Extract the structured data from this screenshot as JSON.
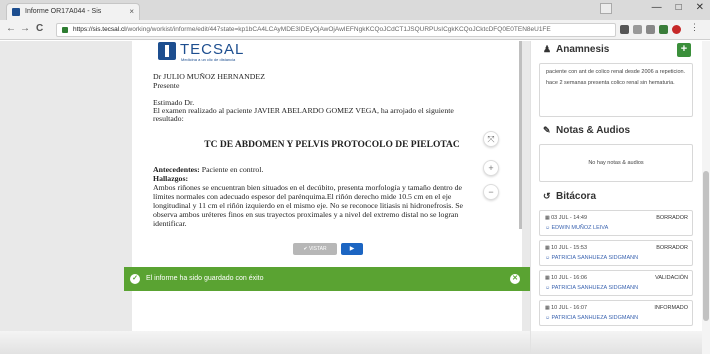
{
  "browser": {
    "tab_title": "Informe OR17A044 - Sis",
    "tab_close": "×",
    "url_host": "https://sis.tecsal.cl",
    "url_path": "/working/workist/informe/edit/447state=kp1bCA4LCAyMDE3IDEyOjAwOjAwIEFNgkKCQoJCdCT1JSQURPUsICgkKCQoJCktcDFQ0E0TEN8eU1FE",
    "back": "←",
    "forward": "→",
    "reload": "C",
    "minimize": "—",
    "maximize": "□",
    "close": "✕"
  },
  "document": {
    "logo_name": "TECSAL",
    "logo_tagline": "Medicina a un clic de distancia",
    "doctor": "Dr JULIO MUÑOZ HERNANDEZ",
    "present": "Presente",
    "greeting": "Estimado Dr.",
    "intro_1": "El examen realizado al paciente JAVIER ABELARDO GOMEZ VEGA, ha arrojado el siguiente",
    "intro_2": "resultado:",
    "title": "TC DE ABDOMEN Y PELVIS PROTOCOLO DE PIELOTAC",
    "antecedentes_label": "Antecedentes:",
    "antecedentes_value": " Paciente en control.",
    "hallazgos_label": "Hallazgos:",
    "hallazgos_text": "Ambos riñones se encuentran bien situados en el decúbito, presenta morfología y tamaño dentro de límites normales con adecuado espesor del parénquima.El riñón derecho mide 10.5 cm en el eje longitudinal y 11 cm el riñón izquierdo en el mismo eje. No se reconoce litiasis ni hidronefrosis. Se observa ambos uréteres finos en sus trayectos proximales y a nivel del extremo distal no se logran identificar."
  },
  "zoom": {
    "fit": "⤧",
    "in": "+",
    "out": "−"
  },
  "actions": {
    "visar_label": "✔ VISTAR",
    "send_label": "▶"
  },
  "toast": {
    "message": "El informe ha sido guardado con éxito",
    "check": "✓",
    "close": "✕"
  },
  "sidebar": {
    "anamnesis": {
      "title": "Anamnesis",
      "add": "+",
      "note_1": "paciente con ant de colico renal desde 2006 a repeticion.",
      "note_2": "hace 2 semanas presenta colico renal sin hematuria."
    },
    "notas": {
      "title": "Notas & Audios",
      "empty": "No hay notas & audios"
    },
    "bitacora": {
      "title": "Bitácora",
      "entries": [
        {
          "date": "03 JUL - 14:49",
          "status": "BORRADOR",
          "user": "EDWIN MUÑOZ LEIVA"
        },
        {
          "date": "10 JUL - 15:53",
          "status": "BORRADOR",
          "user": "PATRICIA SANHUEZA SIDGMANN"
        },
        {
          "date": "10 JUL - 16:06",
          "status": "VALIDACIÓN",
          "user": "PATRICIA SANHUEZA SIDGMANN"
        },
        {
          "date": "10 JUL - 16:07",
          "status": "INFORMADO",
          "user": "PATRICIA SANHUEZA SIDGMANN"
        }
      ]
    }
  },
  "colors": {
    "toast": "#5aa332",
    "brand": "#1d4e8f",
    "primary": "#1c65c2",
    "add": "#3a8f3a"
  }
}
